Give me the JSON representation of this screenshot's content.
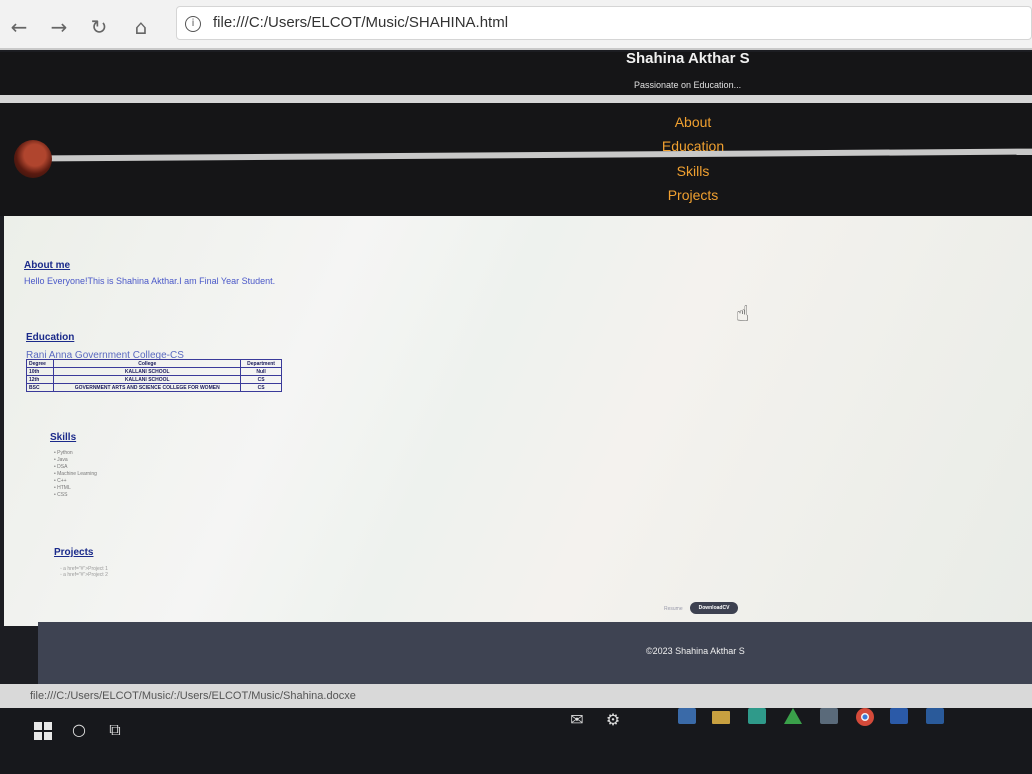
{
  "browser": {
    "back_icon": "arrow-left-icon",
    "forward_icon": "arrow-right-icon",
    "refresh_icon": "refresh-icon",
    "home_icon": "home-icon",
    "url": "file:///C:/Users/ELCOT/Music/SHAHINA.html"
  },
  "header": {
    "name": "Shahina Akthar S",
    "tagline": "Passionate on Education..."
  },
  "nav": {
    "items": [
      "About",
      "Education",
      "Skills",
      "Projects"
    ]
  },
  "about": {
    "title": "About me",
    "text": "Hello Everyone!This is Shahina Akthar.I am Final Year Student."
  },
  "education": {
    "title": "Education",
    "college_heading": "Rani Anna Government College-CS",
    "columns": [
      "Degree",
      "College",
      "Department"
    ],
    "rows": [
      [
        "10th",
        "KALLANI SCHOOL",
        "Null"
      ],
      [
        "12th",
        "KALLANI SCHOOL",
        "CS"
      ],
      [
        "BSC",
        "GOVERNMENT ARTS AND SCIENCE COLLEGE FOR WOMEN",
        "CS"
      ]
    ]
  },
  "skills": {
    "title": "Skills",
    "items": [
      "Python",
      "Java",
      "DSA",
      "Machine Learning",
      "C++",
      "HTML",
      "CSS"
    ]
  },
  "projects": {
    "title": "Projects",
    "items": [
      "a href=\"#\">Project 1",
      "a href=\"#\">Project 2"
    ]
  },
  "download": {
    "label": "Resume",
    "button": "DownloadCV"
  },
  "footer": {
    "text": "©2023 Shahina Akthar S"
  },
  "status_bar": {
    "text": "file:///C:/Users/ELCOT/Music/:/Users/ELCOT/Music/Shahina.docxe"
  },
  "colors": {
    "nav_link": "#f0a030",
    "header_bg": "#151517",
    "footer_bg": "#3e4352",
    "section_title": "#1a2a8a"
  }
}
